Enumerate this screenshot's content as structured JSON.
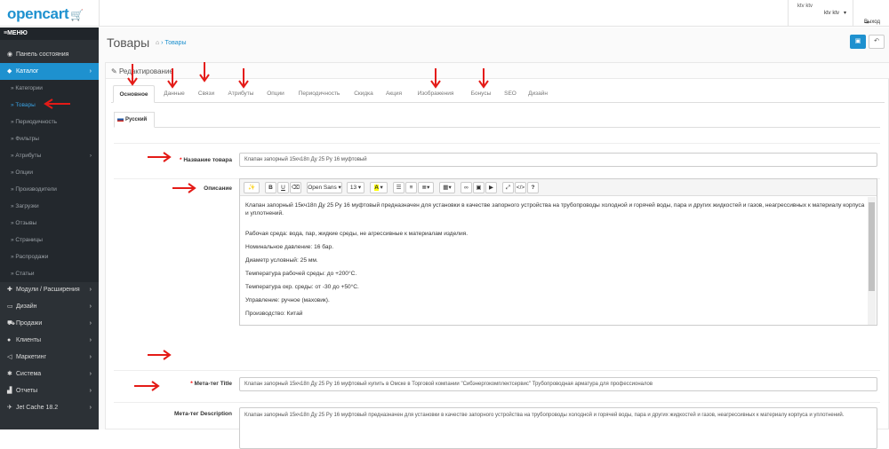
{
  "header": {
    "logo": "opencart",
    "user_img_alt": "ktv ktv",
    "user_first": "ktv ktv",
    "user_second": "ktv ktv",
    "logout": "Выход"
  },
  "sidebar": {
    "menu_label": "МЕНЮ",
    "items": [
      {
        "label": "Панель состояния",
        "icon": "dashboard-icon"
      },
      {
        "label": "Каталог",
        "icon": "tag-icon"
      },
      {
        "label": "Модули / Расширения",
        "icon": "puzzle-icon"
      },
      {
        "label": "Дизайн",
        "icon": "monitor-icon"
      },
      {
        "label": "Продажи",
        "icon": "cart-icon"
      },
      {
        "label": "Клиенты",
        "icon": "user-icon"
      },
      {
        "label": "Маркетинг",
        "icon": "share-icon"
      },
      {
        "label": "Система",
        "icon": "gear-icon"
      },
      {
        "label": "Отчеты",
        "icon": "chart-icon"
      },
      {
        "label": "Jet Cache 18.2",
        "icon": "rocket-icon"
      }
    ],
    "catalog_sub": [
      "Категории",
      "Товары",
      "Периодичность",
      "Фильтры",
      "Атрибуты",
      "Опции",
      "Производители",
      "Загрузки",
      "Отзывы",
      "Страницы",
      "Распродажи",
      "Статьи"
    ]
  },
  "page": {
    "title": "Товары",
    "breadcrumb": "Товары",
    "panel_title": "Редактирование"
  },
  "tabs": [
    "Основное",
    "Данные",
    "Связи",
    "Атрибуты",
    "Опции",
    "Периодичность",
    "Скидка",
    "Акция",
    "Изображения",
    "Бонусы",
    "SEO",
    "Дизайн"
  ],
  "language_tab": "Русский",
  "form": {
    "name_label": "Название товара",
    "name_value": "Клапан запорный 15кч18п Ду 25 Ру 16 муфтовый",
    "desc_label": "Описание",
    "font_name": "Open Sans",
    "font_size": "13",
    "description": [
      "Клапан запорный 15кч18п Ду 25 Ру 16 муфтовый предназначен для установки в качестве запорного устройства на трубопроводы холодной и горячей воды, пара и других жидкостей и газов, неагрессивных к материалу корпуса и уплотнений.",
      "Рабочая среда: вода, пар, жидкие среды, не агрессивные к материалам изделия.",
      "Номинальное давление: 16 бар.",
      "Диаметр условный: 25 мм.",
      "Температура рабочей среды: до +200°С.",
      "Температура окр. среды: от -30 до +50°С.",
      "Управление: ручное (маховик).",
      "Производство: Китай"
    ],
    "meta_title_label": "Мета-тег Title",
    "meta_title_value": "Клапан запорный 15кч18п Ду 25 Ру 16 муфтовый купить в Омске в Торговой компании \"Сибэнергокомплектсервис\" Трубопроводная арматура для профессионалов",
    "meta_desc_label": "Мета-тег Description",
    "meta_desc_value": "Клапан запорный 15кч18п Ду 25 Ру 16 муфтовый предназначен для установки в качестве запорного устройства на трубопроводы холодной и горячей воды, пара и других жидкостей и газов, неагрессивных к материалу корпуса и уплотнений."
  },
  "colors": {
    "accent": "#1e91cf",
    "sidebar": "#2c3136",
    "arrow": "#e41b17"
  }
}
